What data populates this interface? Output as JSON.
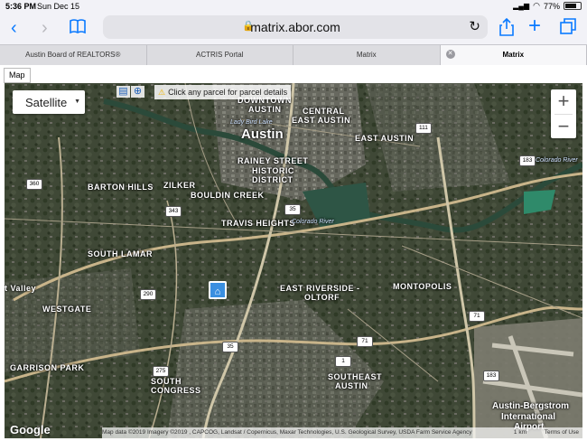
{
  "status": {
    "time": "5:36 PM",
    "date": "Sun Dec 15",
    "battery": "77%",
    "battery_level": 0.77
  },
  "browser": {
    "url": "matrix.abor.com",
    "tabs": [
      {
        "label": "Austin Board of REALTORS®"
      },
      {
        "label": "ACTRIS Portal"
      },
      {
        "label": "Matrix"
      },
      {
        "label": "Matrix"
      }
    ]
  },
  "map": {
    "tab_label": "Map",
    "layer_select": "Satellite",
    "hint": "Click any parcel for parcel details",
    "zoom_in": "+",
    "zoom_out": "−",
    "google_logo": "Google",
    "attribution": "Map data ©2019 Imagery ©2019 , CAPCOG, Landsat / Copernicus, Maxar Technologies, U.S. Geological Survey, USDA Farm Service Agency",
    "scale": "1 km",
    "terms": "Terms of Use",
    "labels": [
      {
        "text": "DOWNTOWN",
        "cls": "n"
      },
      {
        "text": "AUSTIN",
        "cls": "n"
      },
      {
        "text": "CENTRAL",
        "cls": "n"
      },
      {
        "text": "EAST AUSTIN",
        "cls": "n"
      },
      {
        "text": "Austin",
        "cls": "city"
      },
      {
        "text": "EAST AUSTIN",
        "cls": "n"
      },
      {
        "text": "RAINEY STREET",
        "cls": "n"
      },
      {
        "text": "HISTORIC",
        "cls": "n"
      },
      {
        "text": "DISTRICT",
        "cls": "n"
      },
      {
        "text": "BARTON HILLS",
        "cls": "n"
      },
      {
        "text": "ZILKER",
        "cls": "n"
      },
      {
        "text": "BOULDIN CREEK",
        "cls": "n"
      },
      {
        "text": "TRAVIS HEIGHTS",
        "cls": "n"
      },
      {
        "text": "SOUTH LAMAR",
        "cls": "n"
      },
      {
        "text": "EAST RIVERSIDE -",
        "cls": "n"
      },
      {
        "text": "OLTORF",
        "cls": "n"
      },
      {
        "text": "MONTOPOLIS",
        "cls": "n"
      },
      {
        "text": "WESTGATE",
        "cls": "n"
      },
      {
        "text": "GARRISON PARK",
        "cls": "n"
      },
      {
        "text": "SOUTH",
        "cls": "n"
      },
      {
        "text": "CONGRESS",
        "cls": "n"
      },
      {
        "text": "SOUTHEAST",
        "cls": "n"
      },
      {
        "text": "AUSTIN",
        "cls": "n"
      },
      {
        "text": "Austin-Bergstrom",
        "cls": "poi"
      },
      {
        "text": "International",
        "cls": "poi"
      },
      {
        "text": "Airport",
        "cls": "poi"
      },
      {
        "text": "Colorado River",
        "cls": "water"
      },
      {
        "text": "Colorado River",
        "cls": "water"
      },
      {
        "text": "t Valley",
        "cls": "n"
      },
      {
        "text": "Lady Bird Lake",
        "cls": "water"
      }
    ],
    "shields": [
      "35",
      "35",
      "183",
      "71",
      "290",
      "360",
      "343",
      "275",
      "111",
      "183",
      "71",
      "1"
    ]
  }
}
